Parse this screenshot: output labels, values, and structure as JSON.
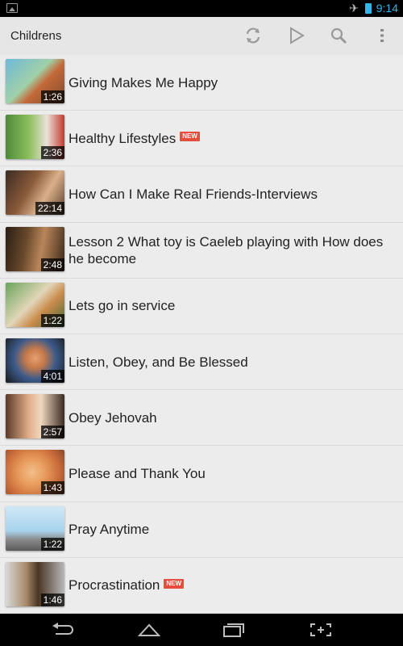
{
  "status_bar": {
    "time": "9:14",
    "icons": [
      "image-notification-icon",
      "airplane-mode-icon",
      "battery-icon"
    ]
  },
  "action_bar": {
    "title": "Childrens",
    "actions": [
      "refresh-icon",
      "play-icon",
      "search-icon",
      "overflow-menu-icon"
    ]
  },
  "videos": [
    {
      "title": "Giving Makes Me Happy",
      "duration": "1:26",
      "is_new": false
    },
    {
      "title": "Healthy Lifestyles",
      "duration": "2:36",
      "is_new": true,
      "badge": "NEW"
    },
    {
      "title": "How Can I Make Real Friends-Interviews",
      "duration": "22:14",
      "is_new": false
    },
    {
      "title": "Lesson 2 What toy is Caeleb playing with How does he become",
      "duration": "2:48",
      "is_new": false
    },
    {
      "title": "Lets go in service",
      "duration": "1:22",
      "is_new": false
    },
    {
      "title": "Listen, Obey, and Be Blessed",
      "duration": "4:01",
      "is_new": false
    },
    {
      "title": "Obey Jehovah",
      "duration": "2:57",
      "is_new": false
    },
    {
      "title": "Please and Thank You",
      "duration": "1:43",
      "is_new": false
    },
    {
      "title": "Pray Anytime",
      "duration": "1:22",
      "is_new": false
    },
    {
      "title": "Procrastination",
      "duration": "1:46",
      "is_new": true,
      "badge": "NEW"
    }
  ],
  "nav_bar": {
    "buttons": [
      "back-icon",
      "home-icon",
      "recent-apps-icon",
      "screenshot-icon"
    ]
  }
}
